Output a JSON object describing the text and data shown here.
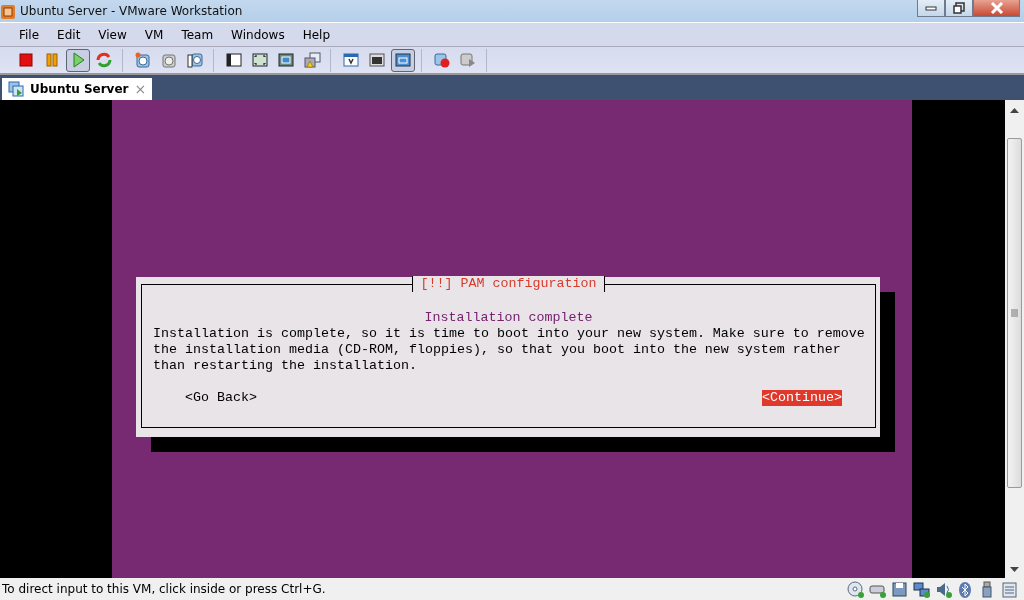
{
  "window": {
    "title": "Ubuntu Server - VMware Workstation"
  },
  "menu": [
    "File",
    "Edit",
    "View",
    "VM",
    "Team",
    "Windows",
    "Help"
  ],
  "toolbar": {
    "groups": [
      [
        {
          "kind": "stop",
          "selected": false
        },
        {
          "kind": "pause",
          "selected": false
        },
        {
          "kind": "play",
          "selected": true
        },
        {
          "kind": "reset",
          "selected": false
        }
      ],
      [
        {
          "kind": "snapshot",
          "selected": false
        },
        {
          "kind": "revert",
          "selected": false
        },
        {
          "kind": "manager",
          "selected": false
        }
      ],
      [
        {
          "kind": "sidebar",
          "selected": false
        },
        {
          "kind": "fullscreen",
          "selected": false
        },
        {
          "kind": "unity",
          "selected": false
        },
        {
          "kind": "multiwin",
          "selected": false
        }
      ],
      [
        {
          "kind": "settings",
          "selected": false
        },
        {
          "kind": "console",
          "selected": false
        },
        {
          "kind": "switch",
          "selected": true
        }
      ],
      [
        {
          "kind": "record",
          "selected": false
        },
        {
          "kind": "replay",
          "selected": false
        }
      ]
    ]
  },
  "tabs": [
    {
      "label": "Ubuntu Server",
      "close": "×",
      "selected": true
    }
  ],
  "dialog": {
    "title": "[!!] PAM configuration",
    "heading": "Installation complete",
    "message": "Installation is complete, so it is time to boot into your new system. Make sure to remove the installation media (CD-ROM, floppies), so that you boot into the new system rather than restarting the installation.",
    "buttons": [
      {
        "label": "<Go Back>",
        "selected": false
      },
      {
        "label": "<Continue>",
        "selected": true
      }
    ]
  },
  "status_bar": {
    "text": "To direct input to this VM, click inside or press Ctrl+G.",
    "icons": [
      {
        "kind": "cd"
      },
      {
        "kind": "hdd"
      },
      {
        "kind": "floppy"
      },
      {
        "kind": "network"
      },
      {
        "kind": "sound"
      },
      {
        "kind": "bluetooth"
      },
      {
        "kind": "usb"
      },
      {
        "kind": "log"
      }
    ]
  }
}
